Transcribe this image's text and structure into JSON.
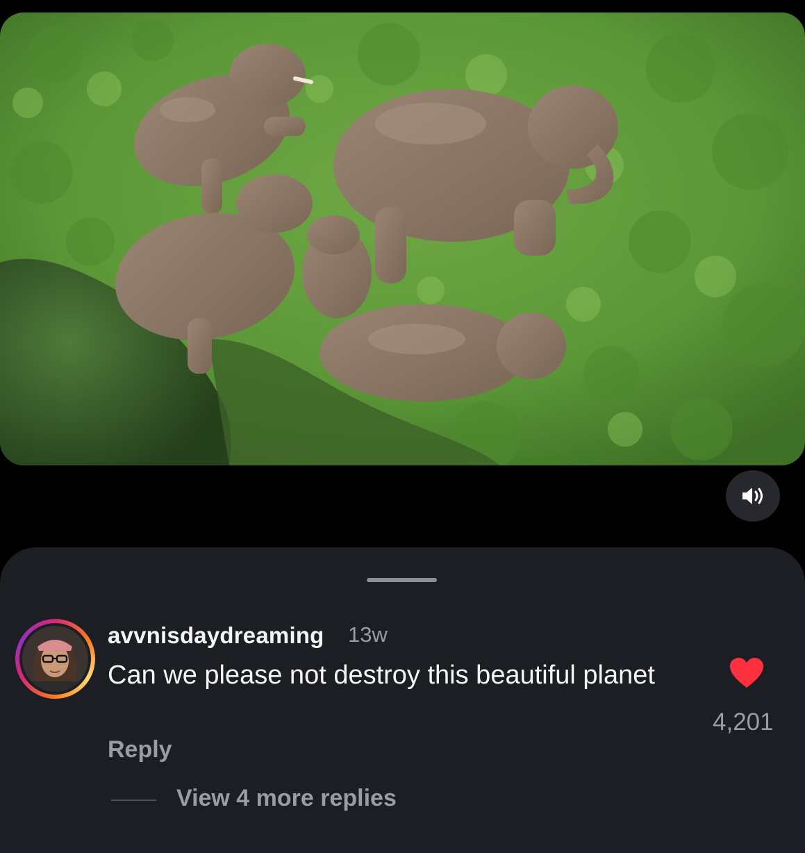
{
  "post": {
    "media_description_icon": "elephants-aerial-photo",
    "sound_icon": "speaker-icon"
  },
  "comment": {
    "username": "avvnisdaydreaming",
    "time": "13w",
    "text": "Can we please not destroy this beautiful planet",
    "reply_label": "Reply",
    "likes": "4,201",
    "liked": true,
    "view_more_label": "View 4 more replies"
  },
  "colors": {
    "sheet_bg": "#1c1e23",
    "heart": "#ff3040",
    "muted_text": "#9a9ca3",
    "primary_text": "#f3f4f6"
  }
}
